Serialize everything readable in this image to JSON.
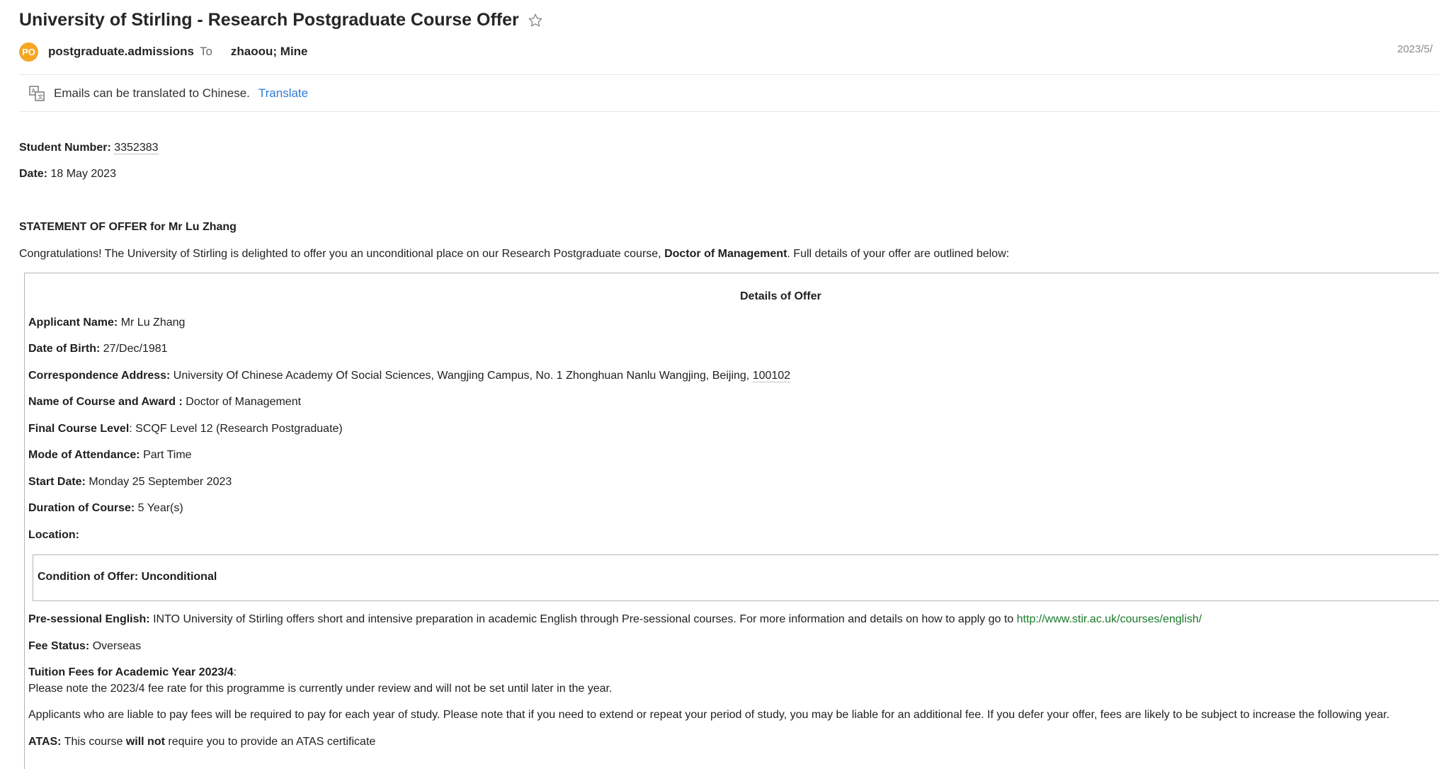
{
  "email": {
    "subject": "University of Stirling - Research Postgraduate Course Offer",
    "sender_initials": "PO",
    "sender": "postgraduate.admissions",
    "to_label": "To",
    "recipients": "zhaoou; Mine",
    "date": "2023/5/"
  },
  "translate": {
    "message": "Emails can be translated to Chinese.",
    "link": "Translate"
  },
  "letter": {
    "student_number_label": "Student Number:",
    "student_number": "3352383",
    "date_label": "Date:",
    "date": "18 May 2023",
    "statement_title": "STATEMENT OF OFFER for Mr Lu Zhang",
    "congrats_pre": "Congratulations! The University of Stirling is delighted to offer you an unconditional place on our Research Postgraduate course,",
    "congrats_course": "Doctor of Management",
    "congrats_post": ". Full details of your offer are outlined below:"
  },
  "details": {
    "title": "Details of Offer",
    "applicant_name_label": "Applicant Name:",
    "applicant_name": "Mr Lu Zhang",
    "dob_label": "Date of Birth:",
    "dob": "27/Dec/1981",
    "address_label": "Correspondence Address:",
    "address": "University Of Chinese Academy Of Social Sciences, Wangjing Campus, No. 1 Zhonghuan Nanlu Wangjing, Beijing,",
    "postcode": "100102",
    "course_label": "Name of Course and Award :",
    "course": "Doctor of Management",
    "level_label": "Final Course Level",
    "level": ": SCQF Level 12 (Research Postgraduate)",
    "mode_label": "Mode of Attendance:",
    "mode": "Part Time",
    "start_label": "Start Date:",
    "start": "Monday 25 September 2023",
    "duration_label": "Duration of Course:",
    "duration": "5 Year(s)",
    "location_label": "Location:",
    "condition": "Condition of Offer: Unconditional",
    "presessional_label": "Pre-sessional English:",
    "presessional": "INTO University of Stirling offers short and intensive preparation in academic English through Pre-sessional courses. For more information and details on how to apply go to",
    "presessional_link": "http://www.stir.ac.uk/courses/english/",
    "fee_status_label": "Fee Status:",
    "fee_status": "Overseas",
    "tuition_label": "Tuition Fees for Academic Year 2023/4",
    "tuition_colon": ":",
    "tuition_note": "Please note the 2023/4 fee rate for this programme is currently under review and will not be set until later in the year.",
    "applicants_note": "Applicants who are liable to pay fees will be required to pay for each year of study. Please note that if you need to extend or repeat your period of study, you may be liable for an additional fee. If you defer your offer, fees are likely to be subject to increase the following year.",
    "atas_label": "ATAS:",
    "atas_pre": "This course",
    "atas_bold": "will not",
    "atas_post": "require you to provide an ATAS certificate"
  }
}
